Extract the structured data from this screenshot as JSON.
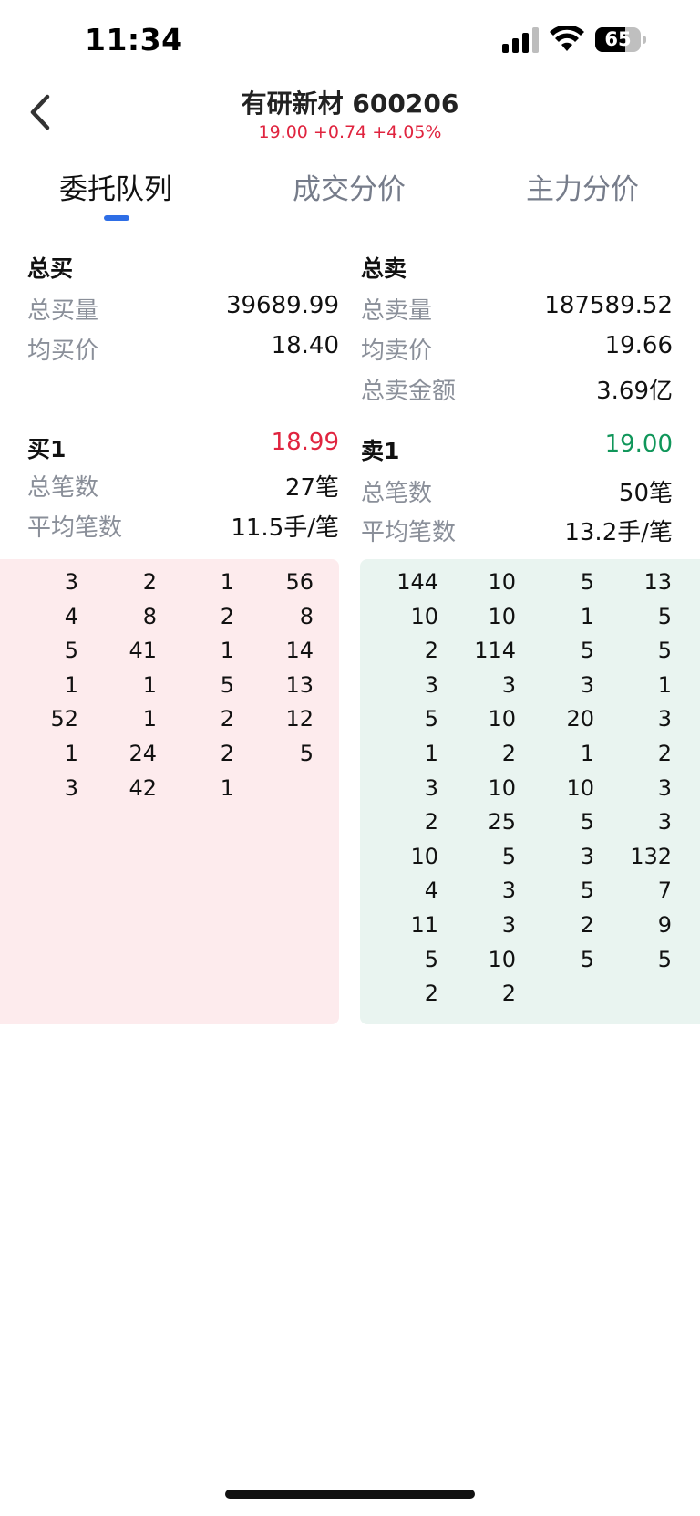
{
  "status_bar": {
    "time": "11:34",
    "battery": "65"
  },
  "header": {
    "title": "有研新材 600206",
    "quote": "19.00 +0.74 +4.05%"
  },
  "tabs": [
    {
      "label": "委托队列",
      "active": true
    },
    {
      "label": "成交分价",
      "active": false
    },
    {
      "label": "主力分价",
      "active": false
    }
  ],
  "buy": {
    "heading": "总买",
    "rows": [
      {
        "label": "总买量",
        "value": "39689.99"
      },
      {
        "label": "均买价",
        "value": "18.40"
      }
    ],
    "level1": {
      "label": "买1",
      "value": "18.99"
    },
    "level_rows": [
      {
        "label": "总笔数",
        "value": "27笔"
      },
      {
        "label": "平均笔数",
        "value": "11.5手/笔"
      }
    ],
    "queue": [
      [
        "3",
        "2",
        "1",
        "56"
      ],
      [
        "4",
        "8",
        "2",
        "8"
      ],
      [
        "5",
        "41",
        "1",
        "14"
      ],
      [
        "1",
        "1",
        "5",
        "13"
      ],
      [
        "52",
        "1",
        "2",
        "12"
      ],
      [
        "1",
        "24",
        "2",
        "5"
      ],
      [
        "3",
        "42",
        "1",
        ""
      ]
    ]
  },
  "sell": {
    "heading": "总卖",
    "rows": [
      {
        "label": "总卖量",
        "value": "187589.52"
      },
      {
        "label": "均卖价",
        "value": "19.66"
      },
      {
        "label": "总卖金额",
        "value": "3.69亿"
      }
    ],
    "level1": {
      "label": "卖1",
      "value": "19.00"
    },
    "level_rows": [
      {
        "label": "总笔数",
        "value": "50笔"
      },
      {
        "label": "平均笔数",
        "value": "13.2手/笔"
      }
    ],
    "queue": [
      [
        "144",
        "10",
        "5",
        "13"
      ],
      [
        "10",
        "10",
        "1",
        "5"
      ],
      [
        "2",
        "114",
        "5",
        "5"
      ],
      [
        "3",
        "3",
        "3",
        "1"
      ],
      [
        "5",
        "10",
        "20",
        "3"
      ],
      [
        "1",
        "2",
        "1",
        "2"
      ],
      [
        "3",
        "10",
        "10",
        "3"
      ],
      [
        "2",
        "25",
        "5",
        "3"
      ],
      [
        "10",
        "5",
        "3",
        "132"
      ],
      [
        "4",
        "3",
        "5",
        "7"
      ],
      [
        "11",
        "3",
        "2",
        "9"
      ],
      [
        "5",
        "10",
        "5",
        "5"
      ],
      [
        "2",
        "2",
        "",
        ""
      ]
    ]
  },
  "colors": {
    "up": "#e0243f",
    "down": "#10965a",
    "accent": "#2e6ee6",
    "buy_bg": "#fdebed",
    "sell_bg": "#e9f4f0"
  }
}
